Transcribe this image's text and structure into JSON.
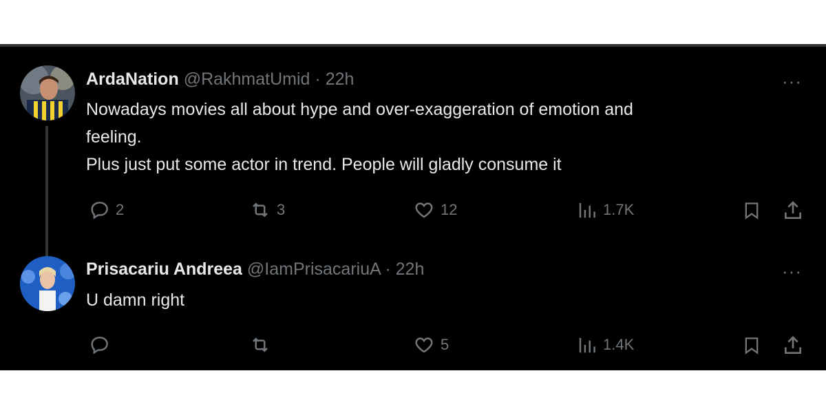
{
  "tweets": [
    {
      "author": "ArdaNation",
      "handle": "@RakhmatUmid",
      "separator": "·",
      "time": "22h",
      "more": "···",
      "lines": [
        "Nowadays movies all about hype and over-exaggeration of emotion and",
        "feeling.",
        "Plus just put some actor in trend. People will gladly consume it"
      ],
      "replies": "2",
      "reposts": "3",
      "likes": "12",
      "views": "1.7K"
    },
    {
      "author": "Prisacariu Andreea",
      "handle": "@IamPrisacariuA",
      "separator": "·",
      "time": "22h",
      "more": "···",
      "lines": [
        "U damn right"
      ],
      "replies": "",
      "reposts": "",
      "likes": "5",
      "views": "1.4K"
    }
  ],
  "icons": {
    "reply": "reply-icon",
    "repost": "repost-icon",
    "like": "heart-icon",
    "views": "views-icon",
    "bookmark": "bookmark-icon",
    "share": "share-icon",
    "more": "more-icon"
  },
  "colors": {
    "background": "#000000",
    "text": "#e7e9ea",
    "muted": "#71767b",
    "thread_line": "#333639"
  }
}
